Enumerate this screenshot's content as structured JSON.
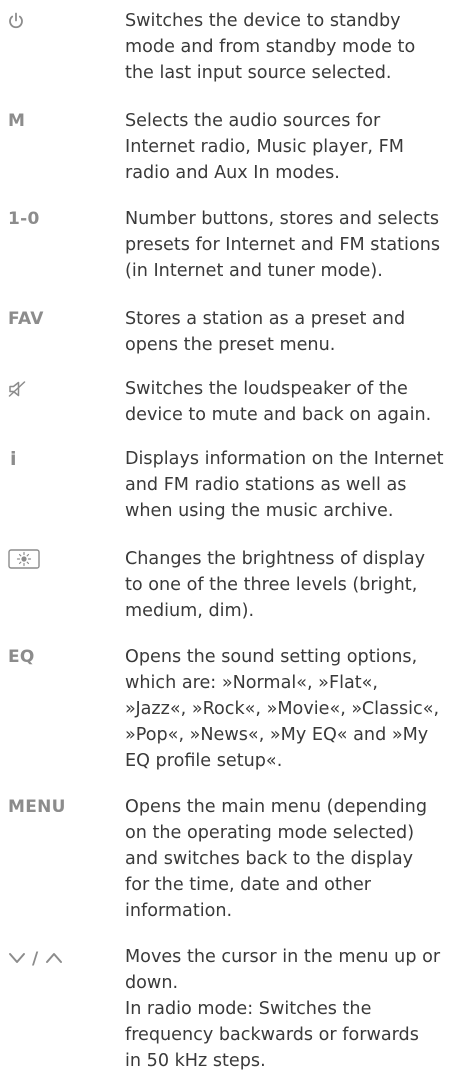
{
  "entries": [
    {
      "icon": "power-icon",
      "key": "",
      "lines": [
        "Switches the device to standby",
        "mode and from standby mode to",
        "the last input source selected."
      ]
    },
    {
      "key": "M",
      "lines": [
        "Selects the audio sources for",
        "Internet radio, Music player, FM",
        "radio and Aux In modes."
      ]
    },
    {
      "key": "1-0",
      "lines": [
        "Number buttons, stores and selects",
        "presets for Internet and FM stations",
        "(in Internet and tuner mode)."
      ]
    },
    {
      "key": "FAV",
      "lines": [
        "Stores a station as a preset and",
        "opens the preset menu."
      ]
    },
    {
      "icon": "mute-icon",
      "key": "",
      "lines": [
        "Switches the loudspeaker of the",
        "device to mute and back on again."
      ]
    },
    {
      "key": "i",
      "lines": [
        "Displays information on the Internet",
        "and FM radio stations as well as",
        "when using the music archive."
      ]
    },
    {
      "icon": "brightness-icon",
      "key": "",
      "lines": [
        "Changes the brightness of display",
        "to one of the three levels (bright,",
        "medium, dim)."
      ]
    },
    {
      "key": "EQ",
      "lines": [
        "Opens the sound setting options,",
        "which are: »Normal«, »Flat«,",
        "»Jazz«, »Rock«, »Movie«, »Classic«,",
        "»Pop«, »News«, »My EQ« and »My",
        "EQ profile setup«."
      ]
    },
    {
      "key": "MENU",
      "lines": [
        "Opens the main menu (depending",
        "on the operating mode selected)",
        "and switches back to the display",
        "for the time, date and other",
        "information."
      ]
    },
    {
      "icon": "down-up-icon",
      "key": "/",
      "lines": [
        "Moves the cursor in the menu up or",
        "down.",
        "In radio mode: Switches the",
        "frequency backwards or forwards",
        "in 50 kHz steps."
      ]
    }
  ]
}
